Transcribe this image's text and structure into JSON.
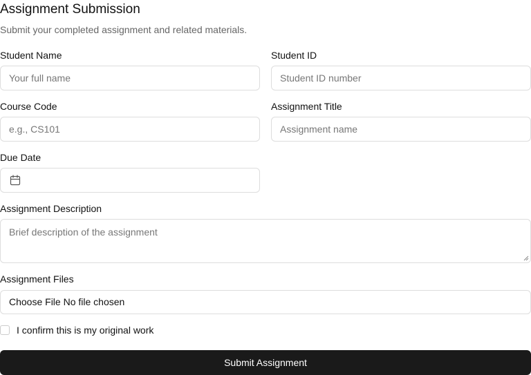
{
  "form": {
    "title": "Assignment Submission",
    "subtitle": "Submit your completed assignment and related materials."
  },
  "fields": {
    "student_name": {
      "label": "Student Name",
      "placeholder": "Your full name",
      "value": ""
    },
    "student_id": {
      "label": "Student ID",
      "placeholder": "Student ID number",
      "value": ""
    },
    "course_code": {
      "label": "Course Code",
      "placeholder": "e.g., CS101",
      "value": ""
    },
    "assignment_title": {
      "label": "Assignment Title",
      "placeholder": "Assignment name",
      "value": ""
    },
    "due_date": {
      "label": "Due Date",
      "value": "",
      "icon": "calendar-icon"
    },
    "description": {
      "label": "Assignment Description",
      "placeholder": "Brief description of the assignment",
      "value": ""
    },
    "files": {
      "label": "Assignment Files",
      "button_text": "Choose File",
      "status_text": "No file chosen"
    }
  },
  "confirmation": {
    "label": "I confirm this is my original work",
    "checked": false
  },
  "submit": {
    "label": "Submit Assignment"
  },
  "colors": {
    "button_bg": "#1a1a1a",
    "button_text": "#ffffff",
    "border": "#dddddd",
    "placeholder": "#777777",
    "subtitle": "#666666"
  }
}
